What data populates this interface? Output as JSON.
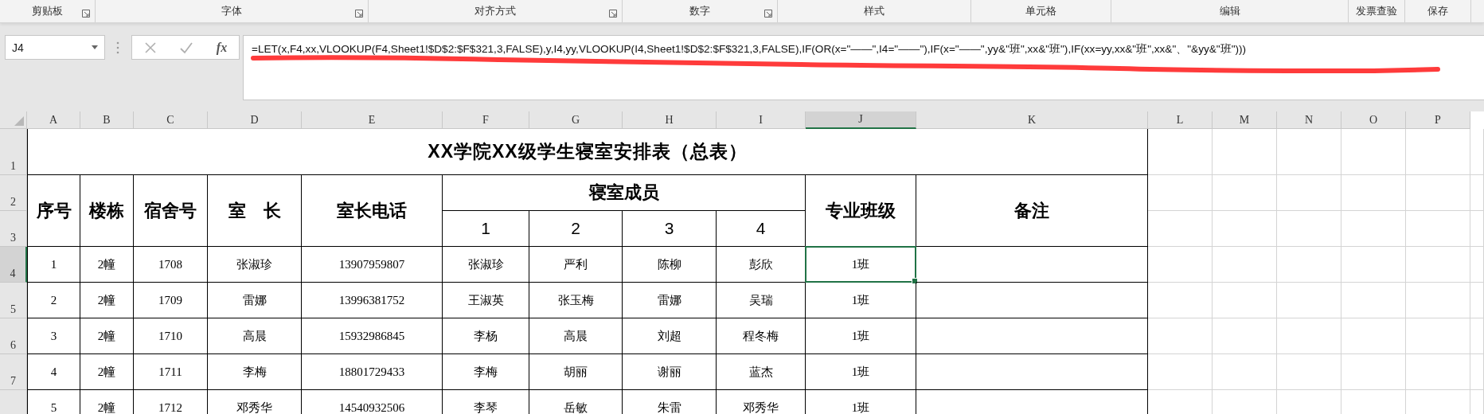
{
  "ribbon_groups": [
    {
      "label": "剪贴板",
      "launcher": true
    },
    {
      "label": "字体",
      "launcher": true
    },
    {
      "label": "对齐方式",
      "launcher": true
    },
    {
      "label": "数字",
      "launcher": true
    },
    {
      "label": "样式",
      "launcher": false
    },
    {
      "label": "单元格",
      "launcher": false
    },
    {
      "label": "编辑",
      "launcher": false
    },
    {
      "label": "发票查验",
      "launcher": false
    },
    {
      "label": "保存",
      "launcher": false
    }
  ],
  "name_box": {
    "value": "J4"
  },
  "formula_bar": {
    "function_label": "fx",
    "formula": "=LET(x,F4,xx,VLOOKUP(F4,Sheet1!$D$2:$F$321,3,FALSE),y,I4,yy,VLOOKUP(I4,Sheet1!$D$2:$F$321,3,FALSE),IF(OR(x=\"——\",I4=\"——\"),IF(x=\"——\",yy&\"班\",xx&\"班\"),IF(xx=yy,xx&\"班\",xx&\"、\"&yy&\"班\")))"
  },
  "column_headers": [
    {
      "label": "A",
      "selected": false
    },
    {
      "label": "B",
      "selected": false
    },
    {
      "label": "C",
      "selected": false
    },
    {
      "label": "D",
      "selected": false
    },
    {
      "label": "E",
      "selected": false
    },
    {
      "label": "F",
      "selected": false
    },
    {
      "label": "G",
      "selected": false
    },
    {
      "label": "H",
      "selected": false
    },
    {
      "label": "I",
      "selected": false
    },
    {
      "label": "J",
      "selected": true
    },
    {
      "label": "K",
      "selected": false
    },
    {
      "label": "L",
      "selected": false
    },
    {
      "label": "M",
      "selected": false
    },
    {
      "label": "N",
      "selected": false
    },
    {
      "label": "O",
      "selected": false
    },
    {
      "label": "P",
      "selected": false
    }
  ],
  "row_headers": [
    {
      "label": "1",
      "selected": false
    },
    {
      "label": "2",
      "selected": false
    },
    {
      "label": "3",
      "selected": false
    },
    {
      "label": "4",
      "selected": true
    },
    {
      "label": "5",
      "selected": false
    },
    {
      "label": "6",
      "selected": false
    },
    {
      "label": "7",
      "selected": false
    }
  ],
  "sheet": {
    "title": "XX学院XX级学生寝室安排表（总表）",
    "headers": [
      "序号",
      "楼栋",
      "宿舍号",
      "室　长",
      "室长电话"
    ],
    "members_header": "寝室成员",
    "member_numbers": [
      "1",
      "2",
      "3",
      "4"
    ],
    "class_header": "专业班级",
    "note_header": "备注",
    "rows": [
      {
        "cells": [
          "1",
          "2幢",
          "1708",
          "张淑珍",
          "13907959807",
          "张淑珍",
          "严利",
          "陈柳",
          "彭欣",
          "1班"
        ],
        "selected": true
      },
      {
        "cells": [
          "2",
          "2幢",
          "1709",
          "雷娜",
          "13996381752",
          "王淑英",
          "张玉梅",
          "雷娜",
          "吴瑞",
          "1班"
        ],
        "selected": false
      },
      {
        "cells": [
          "3",
          "2幢",
          "1710",
          "高晨",
          "15932986845",
          "李杨",
          "高晨",
          "刘超",
          "程冬梅",
          "1班"
        ],
        "selected": false
      },
      {
        "cells": [
          "4",
          "2幢",
          "1711",
          "李梅",
          "18801729433",
          "李梅",
          "胡丽",
          "谢丽",
          "蓝杰",
          "1班"
        ],
        "selected": false
      },
      {
        "cells": [
          "5",
          "2幢",
          "1712",
          "邓秀华",
          "14540932506",
          "李琴",
          "岳敏",
          "朱雷",
          "邓秀华",
          "1班"
        ],
        "selected": false
      }
    ]
  }
}
